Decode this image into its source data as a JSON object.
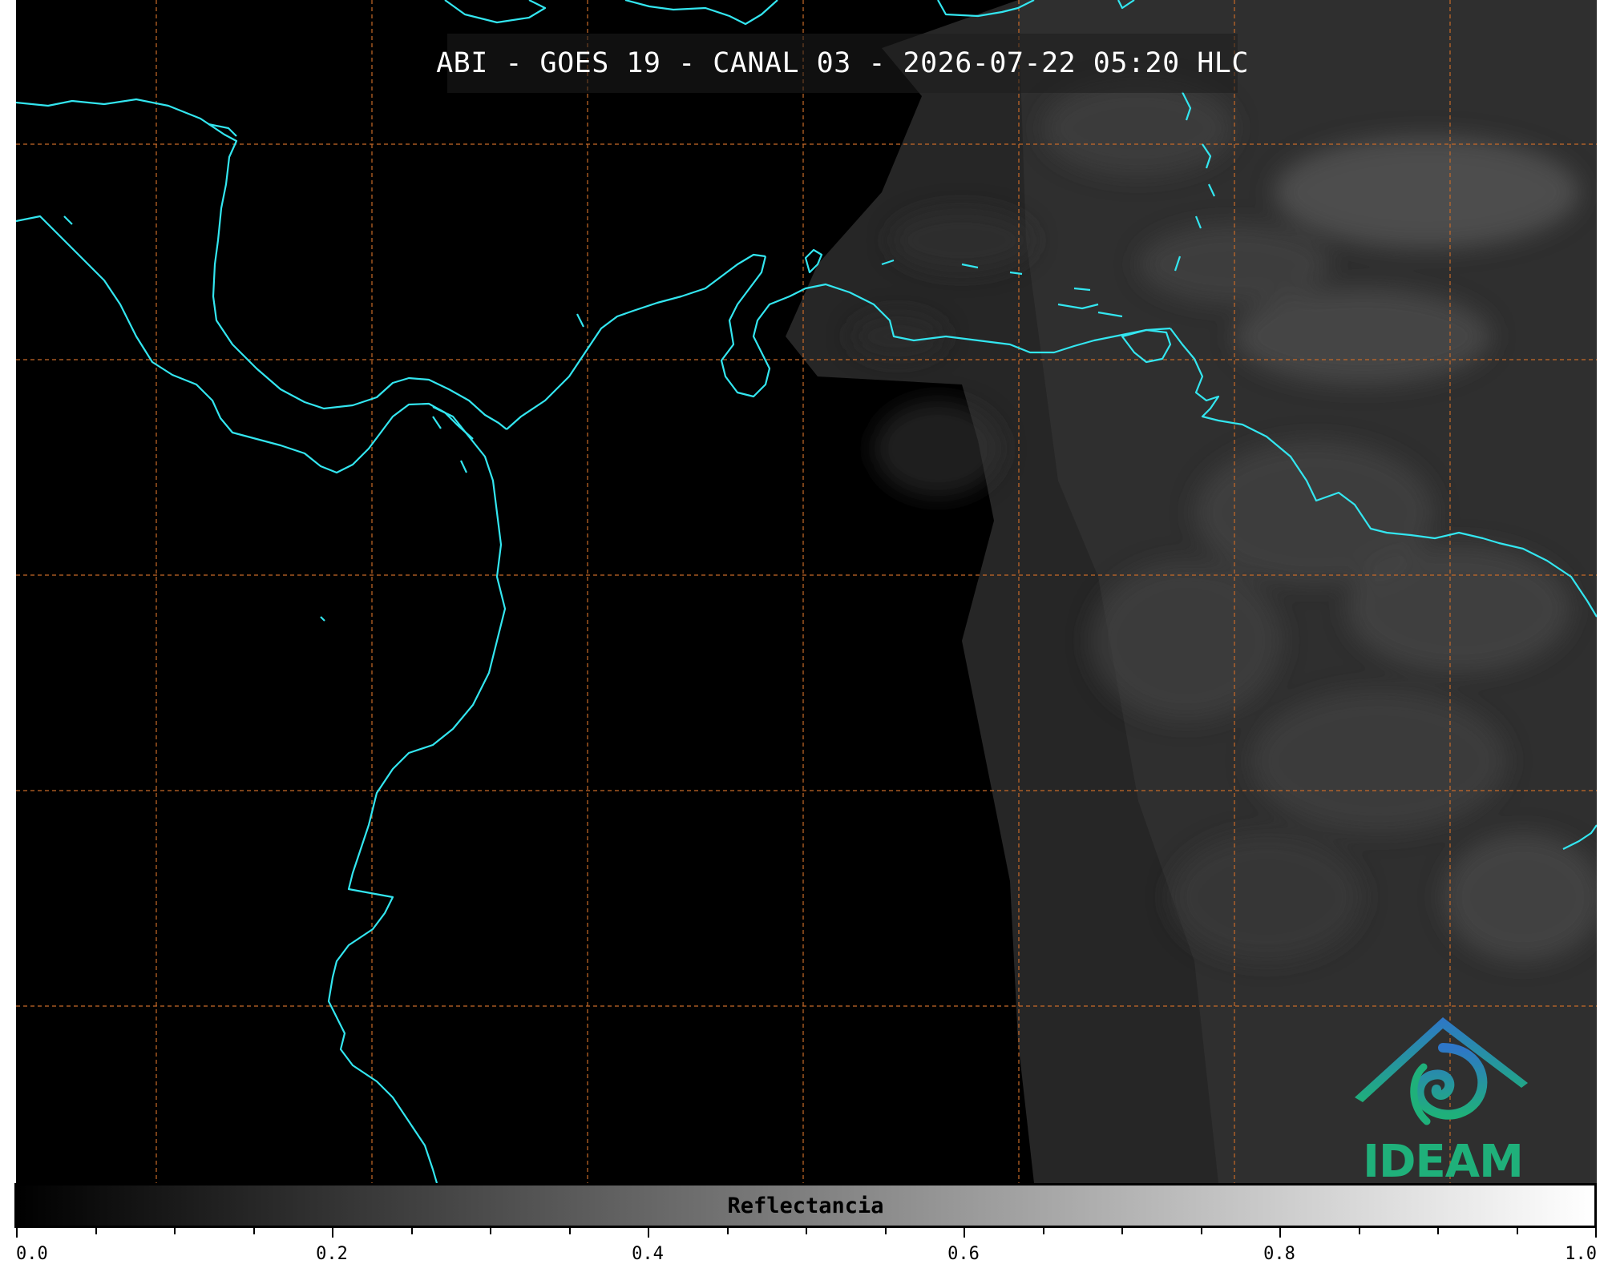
{
  "title": "ABI - GOES 19 - CANAL 03 - 2026-07-22 05:20 HLC",
  "colorbar": {
    "label": "Reflectancia",
    "ticks": [
      "0.0",
      "0.2",
      "0.4",
      "0.6",
      "0.8",
      "1.0"
    ],
    "range": [
      0.0,
      1.0
    ],
    "colors": {
      "low": "#000000",
      "high": "#ffffff"
    }
  },
  "logo": {
    "text": "IDEAM"
  },
  "colors": {
    "coastline": "#33e6f0",
    "grid": "#c86a28",
    "logo_green": "#1fb07a",
    "logo_blue": "#2e76c8"
  }
}
